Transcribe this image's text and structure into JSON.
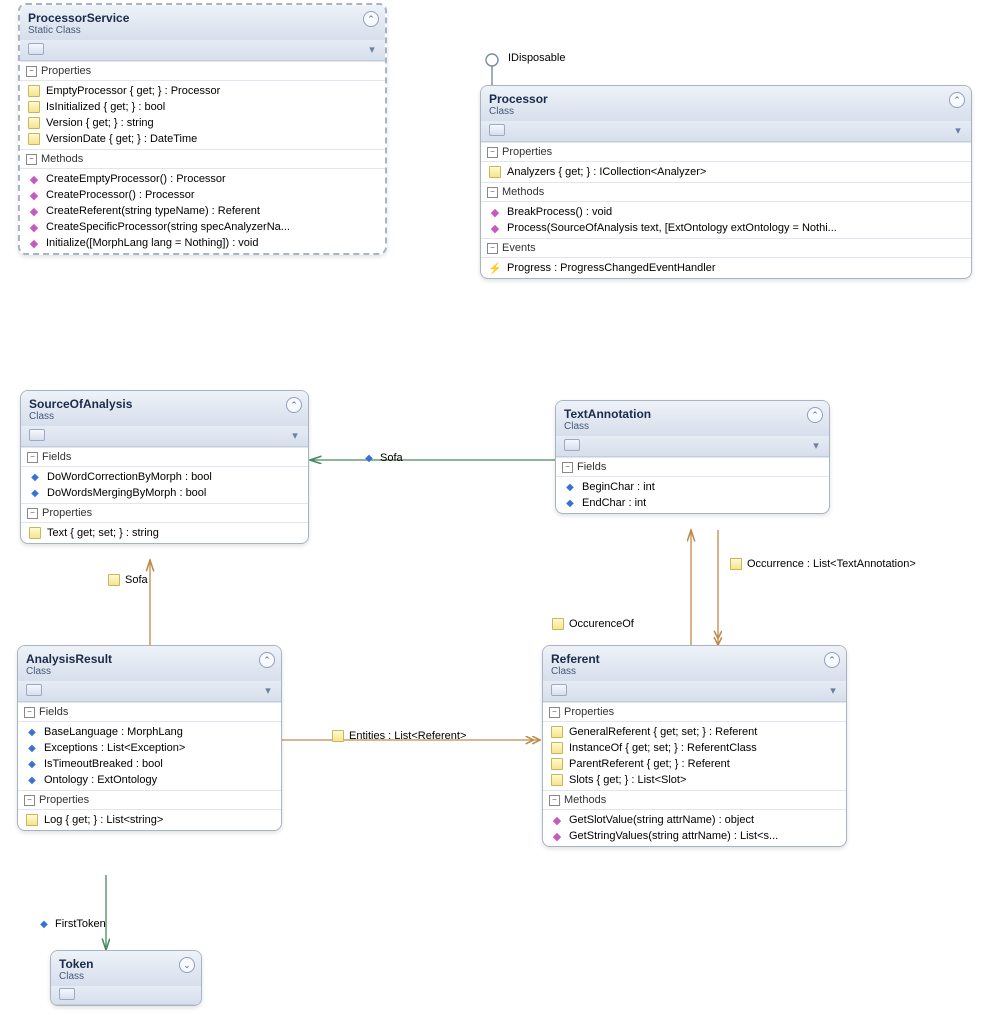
{
  "section_labels": {
    "properties": "Properties",
    "methods": "Methods",
    "fields": "Fields",
    "events": "Events"
  },
  "classes": {
    "processor_service": {
      "name": "ProcessorService",
      "stereotype": "Static Class",
      "properties": [
        "EmptyProcessor { get; } : Processor",
        "IsInitialized { get; } : bool",
        "Version { get; } : string",
        "VersionDate { get; } : DateTime"
      ],
      "methods": [
        "CreateEmptyProcessor() : Processor",
        "CreateProcessor() : Processor",
        "CreateReferent(string typeName) : Referent",
        "CreateSpecificProcessor(string  specAnalyzerNa...",
        "Initialize([MorphLang lang = Nothing]) : void"
      ]
    },
    "processor": {
      "name": "Processor",
      "stereotype": "Class",
      "interface": "IDisposable",
      "properties": [
        "Analyzers { get; } : ICollection<Analyzer>"
      ],
      "methods": [
        "BreakProcess() : void",
        "Process(SourceOfAnalysis text, [ExtOntology extOntology = Nothi..."
      ],
      "events": [
        "Progress : ProgressChangedEventHandler"
      ]
    },
    "source_of_analysis": {
      "name": "SourceOfAnalysis",
      "stereotype": "Class",
      "fields": [
        "DoWordCorrectionByMorph : bool",
        "DoWordsMergingByMorph : bool"
      ],
      "properties": [
        "Text { get; set; } : string"
      ]
    },
    "text_annotation": {
      "name": "TextAnnotation",
      "stereotype": "Class",
      "fields": [
        "BeginChar : int",
        "EndChar : int"
      ]
    },
    "analysis_result": {
      "name": "AnalysisResult",
      "stereotype": "Class",
      "fields": [
        "BaseLanguage : MorphLang",
        "Exceptions : List<Exception>",
        "IsTimeoutBreaked : bool",
        "Ontology : ExtOntology"
      ],
      "properties": [
        "Log { get; } : List<string>"
      ]
    },
    "referent": {
      "name": "Referent",
      "stereotype": "Class",
      "properties": [
        "GeneralReferent { get; set; } : Referent",
        "InstanceOf { get; set; } : ReferentClass",
        "ParentReferent { get; } : Referent",
        "Slots { get; } : List<Slot>"
      ],
      "methods": [
        "GetSlotValue(string attrName) : object",
        "GetStringValues(string attrName) : List<s..."
      ]
    },
    "token": {
      "name": "Token",
      "stereotype": "Class"
    }
  },
  "associations": {
    "sofa1": "Sofa",
    "sofa2": "Sofa",
    "occurrence_of": "OccurenceOf",
    "occurrence": "Occurrence : List<TextAnnotation>",
    "entities": "Entities : List<Referent>",
    "first_token": "FirstToken"
  }
}
